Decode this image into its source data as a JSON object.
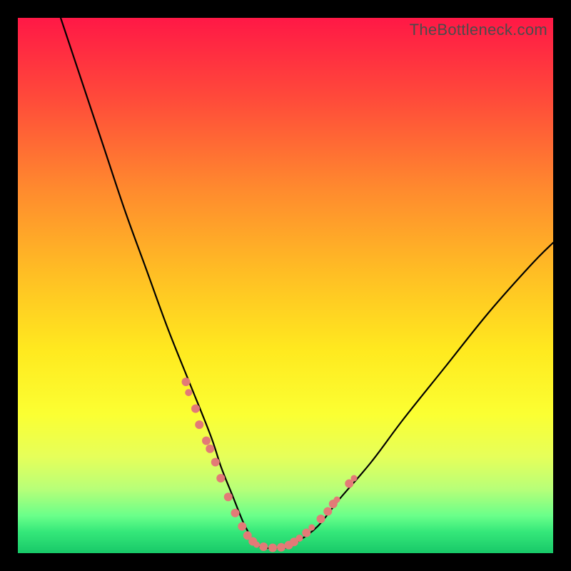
{
  "watermark": "TheBottleneck.com",
  "chart_data": {
    "type": "line",
    "title": "",
    "xlabel": "",
    "ylabel": "",
    "xlim": [
      0,
      100
    ],
    "ylim": [
      0,
      100
    ],
    "series": [
      {
        "name": "curve",
        "x": [
          8,
          12,
          16,
          20,
          24,
          28,
          32,
          36,
          38,
          40,
          42,
          43,
          44,
          46,
          48,
          50,
          52,
          56,
          60,
          66,
          72,
          80,
          88,
          96,
          100
        ],
        "values": [
          100,
          88,
          76,
          64,
          53,
          42,
          32,
          22,
          16,
          11,
          6,
          4,
          2,
          1,
          1,
          1,
          2,
          5,
          10,
          17,
          25,
          35,
          45,
          54,
          58
        ]
      }
    ],
    "markers": {
      "name": "dots",
      "color": "#e37a77",
      "points": [
        {
          "x": 31.4,
          "y": 32,
          "r": 6
        },
        {
          "x": 31.9,
          "y": 30,
          "r": 5
        },
        {
          "x": 33.2,
          "y": 27,
          "r": 6
        },
        {
          "x": 33.9,
          "y": 24,
          "r": 6
        },
        {
          "x": 35.2,
          "y": 21,
          "r": 6
        },
        {
          "x": 35.9,
          "y": 19.5,
          "r": 6
        },
        {
          "x": 36.9,
          "y": 17,
          "r": 6
        },
        {
          "x": 37.9,
          "y": 14,
          "r": 6
        },
        {
          "x": 39.3,
          "y": 10.5,
          "r": 6
        },
        {
          "x": 40.6,
          "y": 7.5,
          "r": 6
        },
        {
          "x": 41.9,
          "y": 5,
          "r": 6
        },
        {
          "x": 42.9,
          "y": 3.3,
          "r": 6
        },
        {
          "x": 43.9,
          "y": 2.2,
          "r": 6
        },
        {
          "x": 44.6,
          "y": 1.6,
          "r": 4.5
        },
        {
          "x": 45.9,
          "y": 1.2,
          "r": 6
        },
        {
          "x": 47.6,
          "y": 1.0,
          "r": 6
        },
        {
          "x": 49.2,
          "y": 1.1,
          "r": 6
        },
        {
          "x": 50.6,
          "y": 1.5,
          "r": 6
        },
        {
          "x": 51.6,
          "y": 2.1,
          "r": 6
        },
        {
          "x": 52.6,
          "y": 2.8,
          "r": 5
        },
        {
          "x": 53.9,
          "y": 3.8,
          "r": 6
        },
        {
          "x": 54.9,
          "y": 4.8,
          "r": 4.5
        },
        {
          "x": 56.6,
          "y": 6.4,
          "r": 6
        },
        {
          "x": 57.9,
          "y": 7.8,
          "r": 6
        },
        {
          "x": 58.9,
          "y": 9.2,
          "r": 6
        },
        {
          "x": 59.6,
          "y": 10.0,
          "r": 4.5
        },
        {
          "x": 61.9,
          "y": 13.0,
          "r": 6
        },
        {
          "x": 62.8,
          "y": 14.0,
          "r": 4.5
        }
      ]
    }
  }
}
